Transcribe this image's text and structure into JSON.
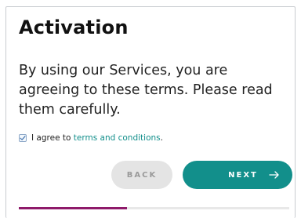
{
  "page": {
    "title": "Activation",
    "description": "By using our Services, you are agreeing to these terms. Please read them carefully."
  },
  "agreement": {
    "checked": true,
    "text_prefix": "I agree to ",
    "link_text": "terms and conditions",
    "text_suffix": "."
  },
  "buttons": {
    "back_label": "BACK",
    "next_label": "NEXT",
    "next_icon": "arrow-right-icon"
  },
  "progress": {
    "fraction": 0.4
  },
  "colors": {
    "accent": "#128f8b",
    "progress": "#8e1a6a",
    "disabled_bg": "#e4e4e4"
  }
}
